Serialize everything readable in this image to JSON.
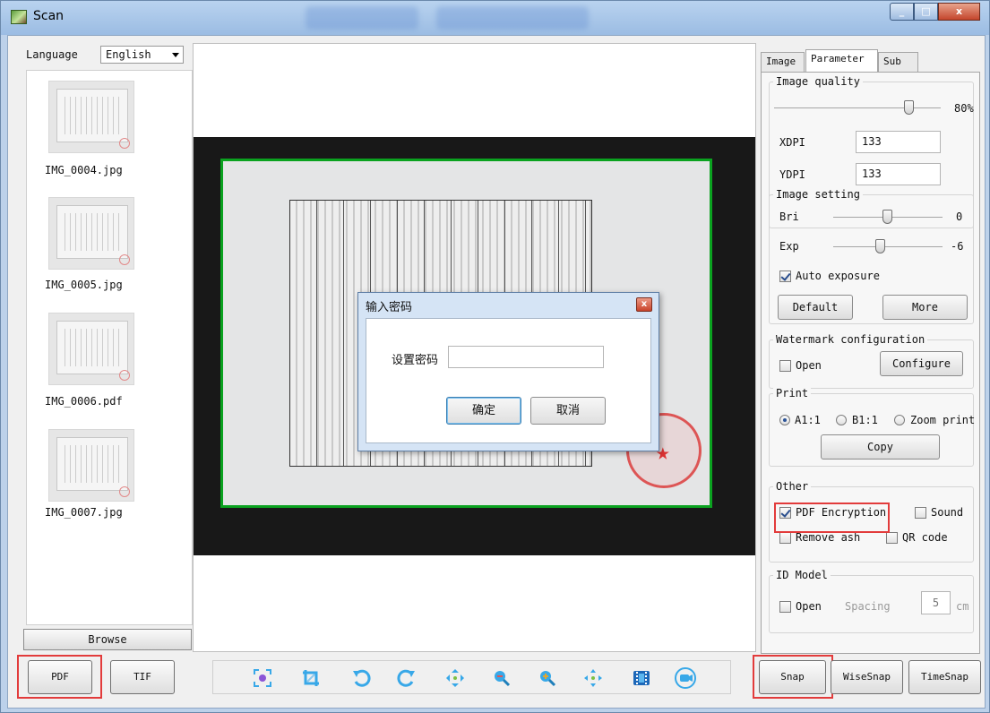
{
  "window": {
    "title": "Scan",
    "minimize_label": "_",
    "maximize_label": "□",
    "close_label": "x"
  },
  "left_panel": {
    "language_label": "Language",
    "language_value": "English",
    "thumbnails": [
      {
        "filename": "IMG_0004.jpg"
      },
      {
        "filename": "IMG_0005.jpg"
      },
      {
        "filename": "IMG_0006.pdf"
      },
      {
        "filename": "IMG_0007.jpg"
      }
    ],
    "browse_label": "Browse",
    "pdf_label": "PDF",
    "tif_label": "TIF"
  },
  "dialog": {
    "title": "输入密码",
    "password_label": "设置密码",
    "password_value": "",
    "ok_label": "确定",
    "cancel_label": "取消"
  },
  "toolbar": {
    "icons": [
      "focus-icon",
      "crop-icon",
      "rotate-left-icon",
      "rotate-right-icon",
      "move-icon",
      "zoom-out-icon",
      "zoom-in-icon",
      "fit-icon",
      "film-icon",
      "camera-icon"
    ]
  },
  "right_panel": {
    "tabs": [
      "Image",
      "Parameter",
      "Sub"
    ],
    "active_tab": "Parameter",
    "image_quality": {
      "title": "Image quality",
      "value_label": "80%",
      "value": 80
    },
    "xdpi_label": "XDPI",
    "xdpi_value": "133",
    "ydpi_label": "YDPI",
    "ydpi_value": "133",
    "image_setting": {
      "title": "Image setting",
      "bri_label": "Bri",
      "bri_value": "0",
      "exp_label": "Exp",
      "exp_value": "-6",
      "auto_exposure_label": "Auto exposure",
      "default_label": "Default",
      "more_label": "More"
    },
    "watermark": {
      "title": "Watermark configuration",
      "open_label": "Open",
      "configure_label": "Configure"
    },
    "print": {
      "title": "Print",
      "option_a1": "A1:1",
      "option_b1": "B1:1",
      "option_zoom": "Zoom print",
      "copy_label": "Copy"
    },
    "other": {
      "title": "Other",
      "pdf_encryption_label": "PDF Encryption",
      "sound_label": "Sound",
      "remove_ash_label": "Remove ash",
      "qr_code_label": "QR code"
    },
    "id_model": {
      "title": "ID Model",
      "open_label": "Open",
      "spacing_label": "Spacing",
      "spacing_value": "5",
      "unit_label": "cm"
    }
  },
  "bottom_buttons": {
    "snap_label": "Snap",
    "wisesnap_label": "WiseSnap",
    "timesnap_label": "TimeSnap"
  },
  "colors": {
    "highlight": "#e23b3b",
    "preview_border": "#0aa21f",
    "toolbar_blue": "#38a8e8"
  }
}
